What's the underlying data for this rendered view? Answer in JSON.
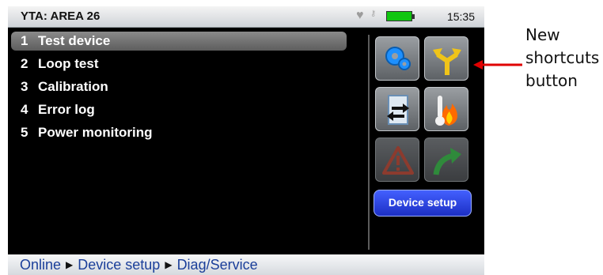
{
  "header": {
    "title": "YTA: AREA 26",
    "time": "15:35"
  },
  "menu": {
    "items": [
      {
        "num": "1",
        "label": "Test device"
      },
      {
        "num": "2",
        "label": "Loop test"
      },
      {
        "num": "3",
        "label": "Calibration"
      },
      {
        "num": "4",
        "label": "Error log"
      },
      {
        "num": "5",
        "label": "Power monitoring"
      }
    ]
  },
  "shortcuts": {
    "icons": [
      "gears-icon",
      "shortcuts-arrow-icon",
      "device-swap-icon",
      "temperature-fire-icon",
      "warning-icon",
      "forward-arrow-icon"
    ],
    "device_setup_label": "Device setup"
  },
  "breadcrumb": {
    "items": [
      "Online",
      "Device setup",
      "Diag/Service"
    ]
  },
  "annotation": {
    "lines": [
      "New",
      "shortcuts",
      "button"
    ],
    "arrow_color": "#e00000"
  },
  "colors": {
    "selection": "#6f6f6f",
    "button_blue": "#2a3fe0",
    "breadcrumb_text": "#1b3f9a"
  }
}
